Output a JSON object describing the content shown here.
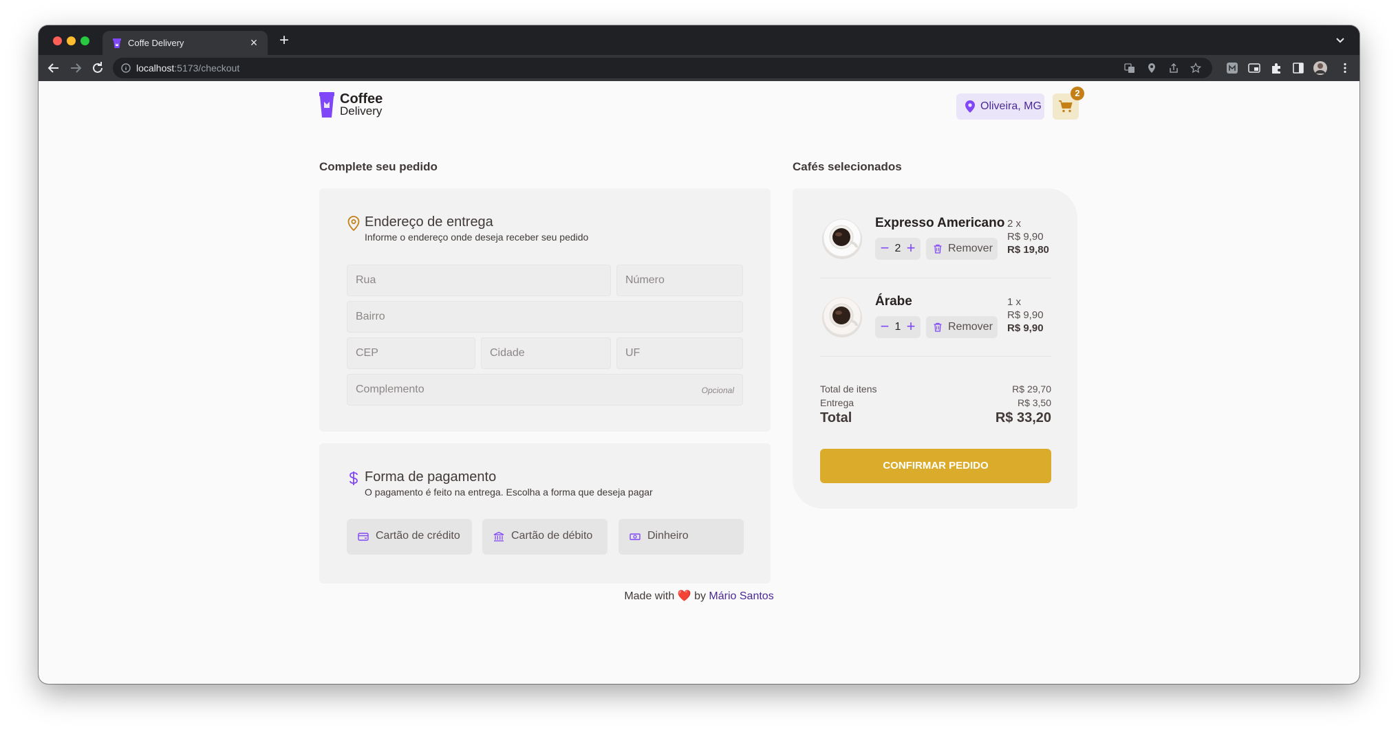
{
  "browser": {
    "tab_title": "Coffe Delivery",
    "url_host": "localhost",
    "url_path": ":5173/checkout"
  },
  "header": {
    "logo_line1": "Coffee",
    "logo_line2": "Delivery",
    "location": "Oliveira, MG",
    "cart_count": "2"
  },
  "checkout": {
    "title": "Complete seu pedido",
    "address": {
      "title": "Endereço de entrega",
      "subtitle": "Informe o endereço onde deseja receber seu pedido",
      "placeholders": {
        "rua": "Rua",
        "numero": "Número",
        "bairro": "Bairro",
        "cep": "CEP",
        "cidade": "Cidade",
        "uf": "UF",
        "complemento": "Complemento",
        "opcional": "Opcional"
      }
    },
    "payment": {
      "title": "Forma de pagamento",
      "subtitle": "O pagamento é feito na entrega. Escolha a forma que deseja pagar",
      "options": [
        "Cartão de crédito",
        "Cartão de débito",
        "Dinheiro"
      ]
    }
  },
  "cart": {
    "title": "Cafés selecionados",
    "items": [
      {
        "name": "Expresso Americano",
        "qty": "2",
        "qty_label": "2 x",
        "unit_price": "R$ 9,90",
        "subtotal": "R$ 19,80",
        "remove_label": "Remover"
      },
      {
        "name": "Árabe",
        "qty": "1",
        "qty_label": "1 x",
        "unit_price": "R$ 9,90",
        "subtotal": "R$ 9,90",
        "remove_label": "Remover"
      }
    ],
    "totals": {
      "items_label": "Total de itens",
      "items_value": "R$ 29,70",
      "delivery_label": "Entrega",
      "delivery_value": "R$ 3,50",
      "total_label": "Total",
      "total_value": "R$ 33,20"
    },
    "confirm_label": "CONFIRMAR PEDIDO"
  },
  "footer": {
    "made_with": "Made with",
    "heart": "❤️",
    "by": "by",
    "author": "Mário Santos"
  },
  "colors": {
    "purple": "#8047f8",
    "purple_dark": "#4b2995",
    "yellow": "#dbac2c",
    "yellow_dark": "#c47f17",
    "base_card": "#f3f2f2"
  }
}
